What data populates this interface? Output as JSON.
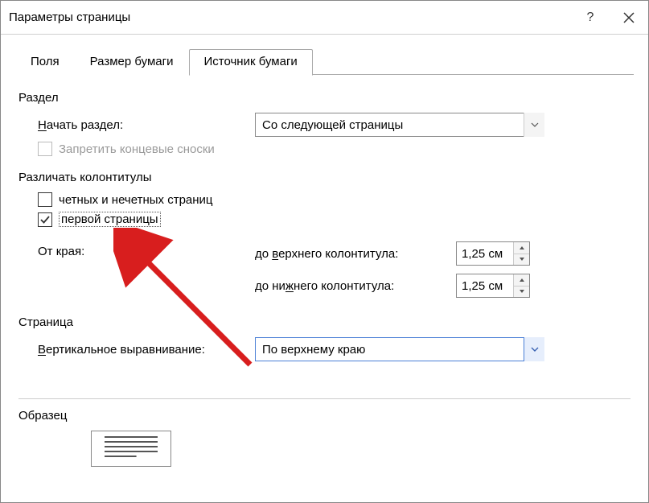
{
  "window": {
    "title": "Параметры страницы",
    "help": "?",
    "close": "×"
  },
  "tabs": {
    "items": [
      {
        "label": "Поля",
        "active": false
      },
      {
        "label": "Размер бумаги",
        "active": false
      },
      {
        "label": "Источник бумаги",
        "active": true
      }
    ]
  },
  "section": {
    "group": "Раздел",
    "start_label_u": "Н",
    "start_label_rest": "ачать раздел:",
    "start_value": "Со следующей страницы",
    "suppress_label": "Запретить концевые сноски",
    "suppress_checked": false,
    "suppress_disabled": true
  },
  "headers": {
    "group": "Различать колонтитулы",
    "odd_even_label": "четных и нечетных страниц",
    "odd_even_checked": false,
    "first_page_label": "первой страницы",
    "first_page_checked": true,
    "from_edge_label": "От края:",
    "header_label_pre": "до ",
    "header_label_u": "в",
    "header_label_rest": "ерхнего колонтитула:",
    "header_value": "1,25 см",
    "footer_label_pre": "до ни",
    "footer_label_u": "ж",
    "footer_label_rest": "него колонтитула:",
    "footer_value": "1,25 см"
  },
  "page": {
    "group": "Страница",
    "valign_label_u": "В",
    "valign_label_rest": "ертикальное выравнивание:",
    "valign_value": "По верхнему краю"
  },
  "preview": {
    "group": "Образец"
  }
}
